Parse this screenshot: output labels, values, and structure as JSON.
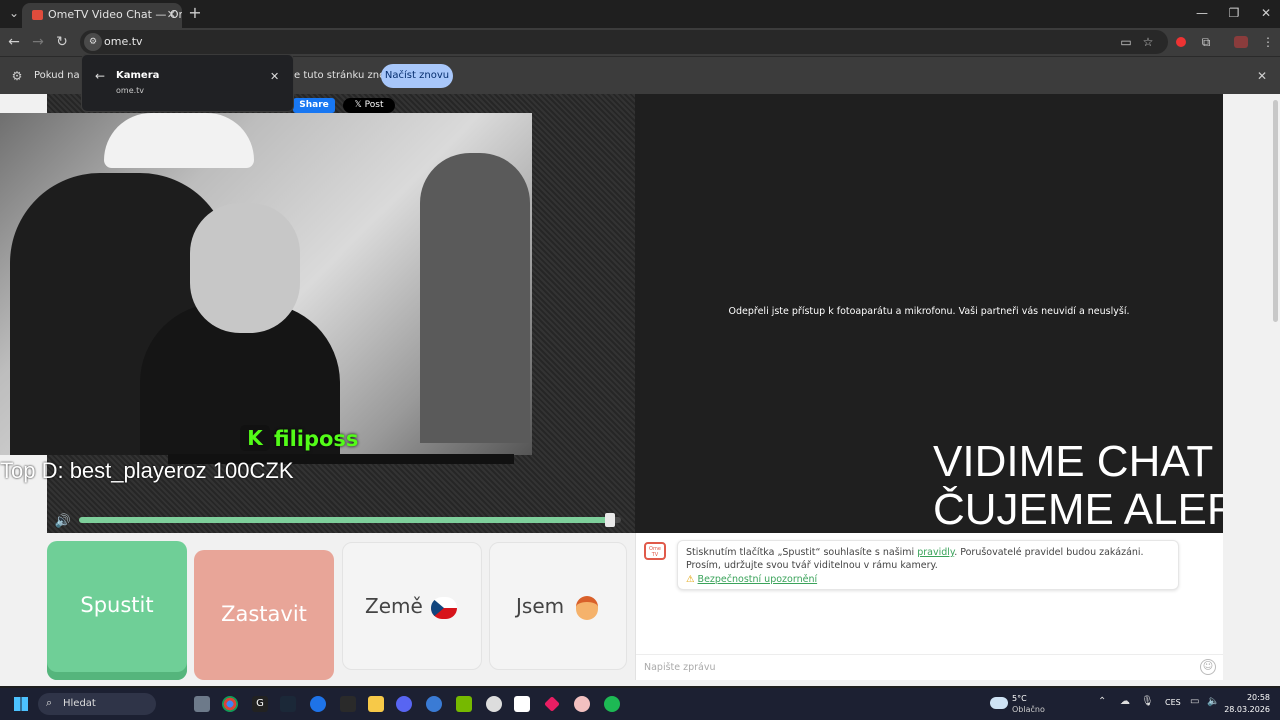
{
  "browser": {
    "tab_title": "OmeTV Video Chat — Omegle",
    "new_tab_symbol": "+",
    "address": "ome.tv",
    "infobar_text_left": "Pokud na to",
    "infobar_text_right": "e tuto stránku znovu",
    "reload_button": "Načíst znovu"
  },
  "popup": {
    "title": "Kamera",
    "subtitle": "ome.tv"
  },
  "share": {
    "facebook": "Share",
    "x": "Post"
  },
  "stream_overlay": {
    "kick_name": "filiposs",
    "top_donation": "Top D: best_playeroz 100CZK",
    "right_line1": "VIDIME CHAT",
    "right_line2": "ČUJEME ALERTY",
    "volume_level": 0.98
  },
  "right_panel": {
    "notice": "Odepřeli jste přístup k fotoaparátu a mikrofonu. Vaši partneři vás neuvidí a neuslyší."
  },
  "buttons": {
    "start": "Spustit",
    "stop": "Zastavit",
    "country": "Země",
    "gender": "Jsem"
  },
  "chat": {
    "msg_part1": "Stisknutím tlačítka „Spustit“ souhlasíte s našimi ",
    "msg_link": "pravidly",
    "msg_part2": ". Porušovatelé pravidel budou zakázáni. Prosím, udržujte svou tvář viditelnou v rámu kamery.",
    "safety_link": "Bezpečnostní upozornění",
    "placeholder": "Napište zprávu"
  },
  "taskbar": {
    "search": "Hledat",
    "weather_temp": "5°C",
    "weather_desc": "Oblačno",
    "lang": "CES",
    "time": "20:58",
    "date": "28.03.2026"
  },
  "colors": {
    "start_green": "#6fcf97",
    "stop_red": "#e8a598",
    "link_green": "#3aa35a",
    "kick_green": "#53fc18"
  }
}
